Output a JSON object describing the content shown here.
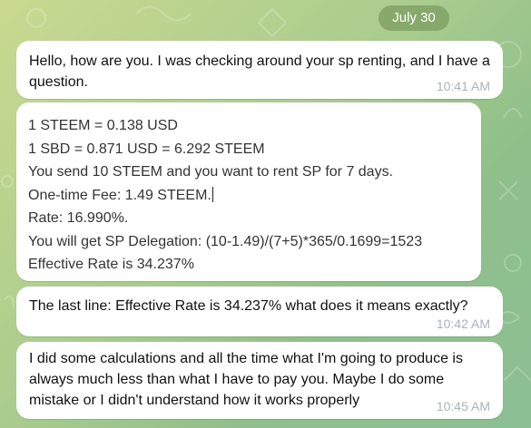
{
  "date_label": "July 30",
  "messages": [
    {
      "text": "Hello, how are you. I was checking around your sp renting, and I have a question.",
      "time": "10:41 AM"
    },
    {
      "image_lines": [
        "1 STEEM = 0.138 USD",
        "1 SBD = 0.871 USD = 6.292 STEEM",
        "You send 10 STEEM and you want to rent SP for 7 days.",
        "One-time Fee: 1.49 STEEM.",
        "Rate: 16.990%.",
        "You will get SP Delegation: (10-1.49)/(7+5)*365/0.1699=1523",
        "Effective Rate is 34.237%"
      ]
    },
    {
      "text": "The last line: Effective Rate is 34.237% what does it means exactly?",
      "time": "10:42 AM"
    },
    {
      "text": "I did some calculations and all the time what I'm going to produce is always much less than what I have to pay you. Maybe I do some mistake or I didn't understand how it works properly",
      "time": "10:45 AM"
    }
  ]
}
